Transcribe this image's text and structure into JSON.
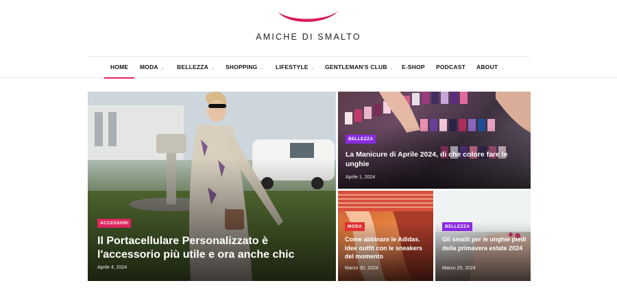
{
  "site": {
    "logo_text": "AMICHE DI SMALTO",
    "brand_color": "#e0245e"
  },
  "nav": {
    "items": [
      {
        "label": "HOME",
        "active": true,
        "has_dropdown": false
      },
      {
        "label": "MODA",
        "has_dropdown": true
      },
      {
        "label": "BELLEZZA",
        "has_dropdown": true
      },
      {
        "label": "SHOPPING",
        "has_dropdown": true
      },
      {
        "label": "LIFESTYLE",
        "has_dropdown": true
      },
      {
        "label": "GENTLEMAN'S CLUB",
        "has_dropdown": true
      },
      {
        "label": "E-SHOP",
        "has_dropdown": false
      },
      {
        "label": "PODCAST",
        "has_dropdown": false
      },
      {
        "label": "ABOUT",
        "has_dropdown": true
      }
    ],
    "dropdown_icon": "chevron-down-icon"
  },
  "posts": {
    "main": {
      "category": "ACCESSORI",
      "category_color": "#e0245e",
      "title": "Il Portacellulare Personalizzato è l'accessorio più utile e ora anche chic",
      "date": "Aprile 4, 2024"
    },
    "top_right": {
      "category": "BELLEZZA",
      "category_color": "#8a2be2",
      "title": "La Manicure di Aprile 2024, di che colore fare le unghie",
      "date": "Aprile 1, 2024"
    },
    "bottom_left": {
      "category": "MODA",
      "category_color": "#e03030",
      "title": "Come abbinare le Adidas. Idee outfit con le sneakers del momento",
      "date": "Marzo 30, 2024"
    },
    "bottom_right": {
      "category": "BELLEZZA",
      "category_color": "#8a2be2",
      "title": "Gli smalti per le unghie piedi della primavera estate 2024",
      "date": "Marzo 29, 2024"
    }
  }
}
